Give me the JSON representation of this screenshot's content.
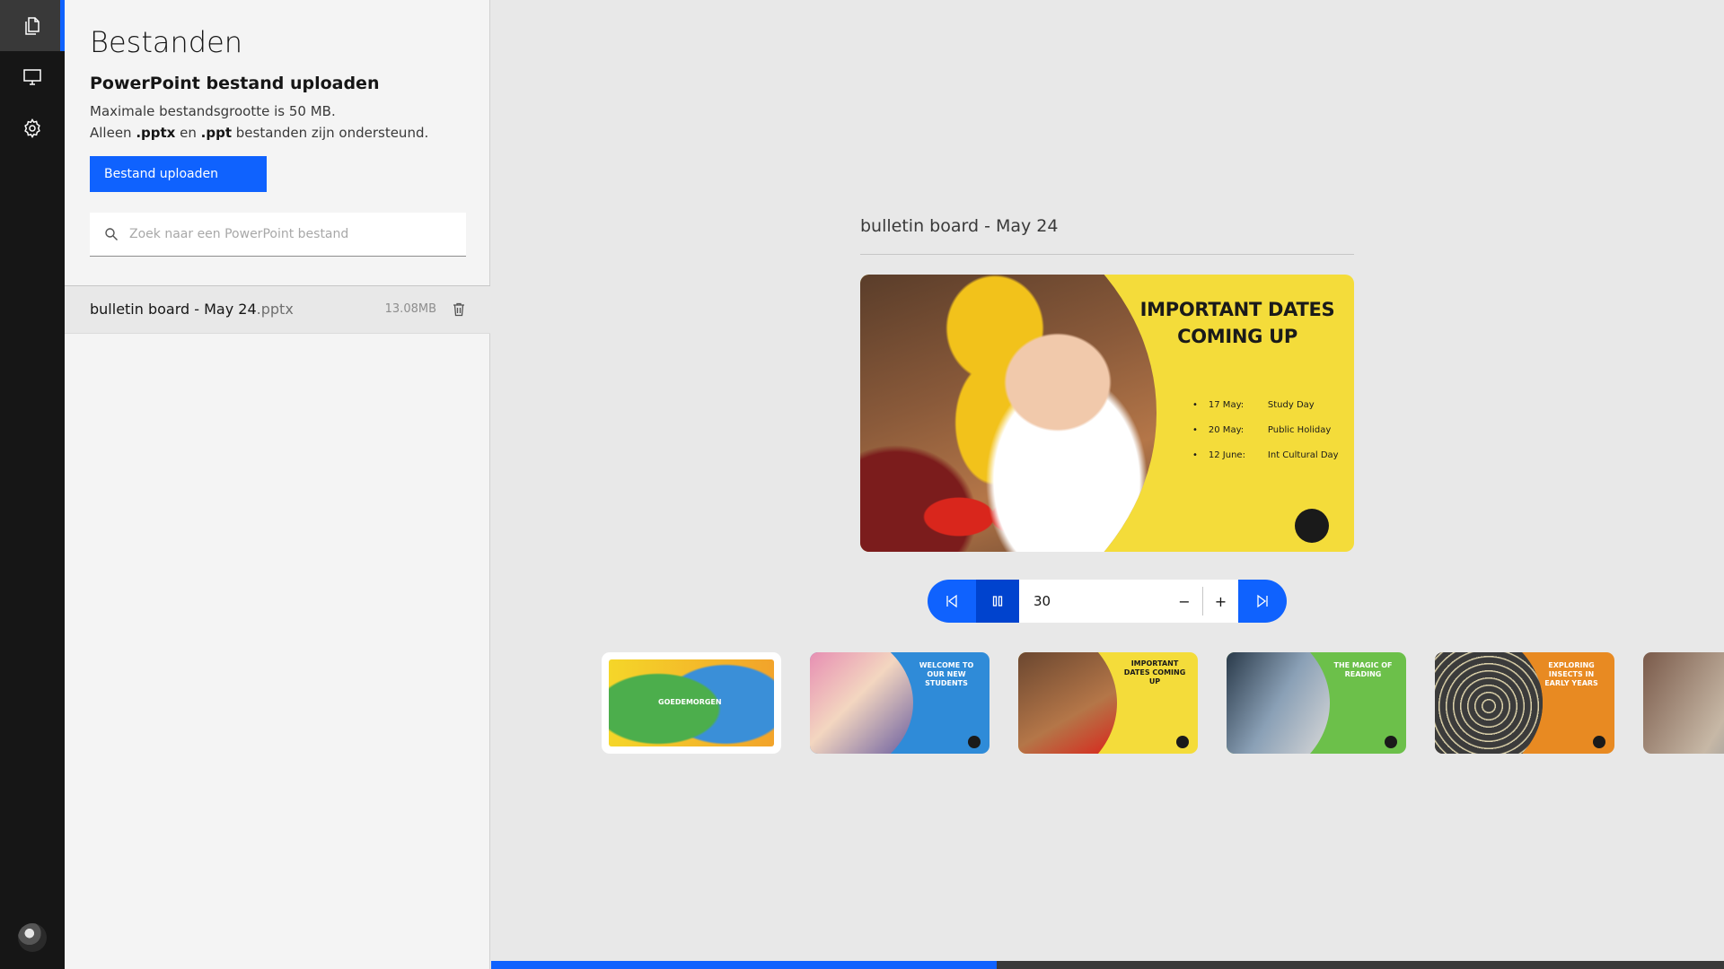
{
  "panel": {
    "title": "Bestanden",
    "subtitle": "PowerPoint bestand uploaden",
    "info_line1": "Maximale bestandsgrootte is 50 MB.",
    "info_prefix": "Alleen ",
    "info_pptx": ".pptx",
    "info_mid": " en ",
    "info_ppt": ".ppt",
    "info_suffix": " bestanden zijn ondersteund.",
    "upload_label": "Bestand uploaden",
    "search_placeholder": "Zoek naar een PowerPoint bestand"
  },
  "files": [
    {
      "name": "bulletin board - May 24",
      "ext": ".pptx",
      "size": "13.08MB"
    }
  ],
  "rail": {
    "items": [
      {
        "icon": "files-icon",
        "active": true
      },
      {
        "icon": "monitor-icon",
        "active": false
      },
      {
        "icon": "settings-icon",
        "active": false
      }
    ]
  },
  "main": {
    "deck_title": "bulletin board - May 24",
    "slide": {
      "heading_line1": "IMPORTANT DATES",
      "heading_line2": "COMING UP",
      "items": [
        {
          "date": "17 May:",
          "label": "Study Day"
        },
        {
          "date": "20 May:",
          "label": "Public Holiday"
        },
        {
          "date": "12 June:",
          "label": "Int Cultural Day"
        }
      ]
    },
    "controls": {
      "duration": "30",
      "minus": "−",
      "plus": "+"
    },
    "thumbnails": [
      {
        "label": "GOEDEMORGEN"
      },
      {
        "label": "WELCOME TO OUR NEW STUDENTS"
      },
      {
        "label": "IMPORTANT DATES COMING UP"
      },
      {
        "label": "THE MAGIC OF READING"
      },
      {
        "label": "EXPLORING INSECTS IN EARLY YEARS"
      },
      {
        "label": ""
      }
    ],
    "progress": 0.41
  },
  "colors": {
    "accent": "#0f62fe",
    "rail_bg": "#161616",
    "panel_bg": "#f4f4f4",
    "slide_yellow": "#f4dc3a"
  }
}
